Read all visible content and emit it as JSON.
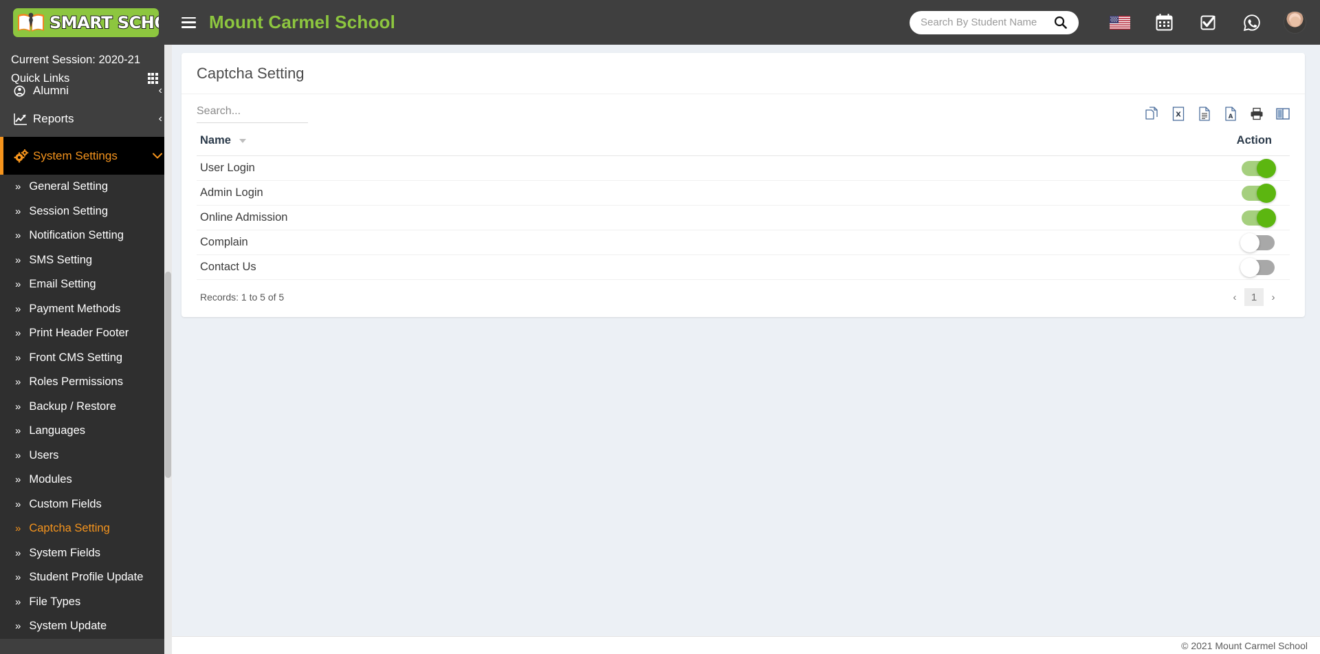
{
  "app": {
    "logo_text": "SMART SCHOOL",
    "brand_title": "Mount Carmel School"
  },
  "topbar": {
    "hamburger_icon": "hamburger-icon",
    "search": {
      "placeholder": "Search By Student Name",
      "value": "",
      "icon": "search-icon"
    },
    "icons": [
      {
        "name": "flag-usa-icon",
        "label": "Language"
      },
      {
        "name": "calendar-icon",
        "label": "Calendar"
      },
      {
        "name": "checkbox-task-icon",
        "label": "Tasks"
      },
      {
        "name": "whatsapp-icon",
        "label": "WhatsApp"
      }
    ],
    "avatar_name": "avatar"
  },
  "sidebar": {
    "session_label": "Current Session: 2020-21",
    "quick_links_label": "Quick Links",
    "quick_links_icon": "grid-icon",
    "top_items": [
      {
        "label": "Alumni",
        "icon": "alumni-icon",
        "caret": "‹",
        "state": "collapsed"
      },
      {
        "label": "Reports",
        "icon": "chart-line-icon",
        "caret": "‹",
        "state": "collapsed"
      },
      {
        "label": "System Settings",
        "icon": "gears-icon",
        "caret": "⌄",
        "state": "expanded"
      }
    ],
    "submenu": [
      {
        "label": "General Setting",
        "active": false
      },
      {
        "label": "Session Setting",
        "active": false
      },
      {
        "label": "Notification Setting",
        "active": false
      },
      {
        "label": "SMS Setting",
        "active": false
      },
      {
        "label": "Email Setting",
        "active": false
      },
      {
        "label": "Payment Methods",
        "active": false
      },
      {
        "label": "Print Header Footer",
        "active": false
      },
      {
        "label": "Front CMS Setting",
        "active": false
      },
      {
        "label": "Roles Permissions",
        "active": false
      },
      {
        "label": "Backup / Restore",
        "active": false
      },
      {
        "label": "Languages",
        "active": false
      },
      {
        "label": "Users",
        "active": false
      },
      {
        "label": "Modules",
        "active": false
      },
      {
        "label": "Custom Fields",
        "active": false
      },
      {
        "label": "Captcha Setting",
        "active": true
      },
      {
        "label": "System Fields",
        "active": false
      },
      {
        "label": "Student Profile Update",
        "active": false
      },
      {
        "label": "File Types",
        "active": false
      },
      {
        "label": "System Update",
        "active": false
      }
    ]
  },
  "page": {
    "title": "Captcha Setting"
  },
  "datatable": {
    "search_placeholder": "Search...",
    "search_value": "",
    "export_buttons": [
      {
        "name": "copy-icon",
        "label": "Copy"
      },
      {
        "name": "excel-icon",
        "label": "Excel"
      },
      {
        "name": "csv-icon",
        "label": "CSV"
      },
      {
        "name": "pdf-icon",
        "label": "PDF"
      },
      {
        "name": "print-icon",
        "label": "Print"
      },
      {
        "name": "column-visibility-icon",
        "label": "Column visibility"
      }
    ],
    "columns": [
      {
        "label": "Name",
        "sortable": true,
        "sort_state": "desc"
      },
      {
        "label": "Action",
        "sortable": false
      }
    ],
    "rows": [
      {
        "name": "User Login",
        "enabled": true
      },
      {
        "name": "Admin Login",
        "enabled": true
      },
      {
        "name": "Online Admission",
        "enabled": true
      },
      {
        "name": "Complain",
        "enabled": false
      },
      {
        "name": "Contact Us",
        "enabled": false
      }
    ],
    "info": "Records: 1 to 5 of 5",
    "pagination": {
      "prev": "‹",
      "pages": [
        "1"
      ],
      "current": "1",
      "next": "›"
    }
  },
  "footer": {
    "copyright": "© 2021 Mount Carmel School"
  },
  "colors": {
    "brand_green": "#8dc63f",
    "accent_orange": "#f5941d",
    "sidebar_bg": "#3f3f3f",
    "submenu_bg": "#2f2f2f",
    "toggle_on": "#5cb610",
    "toggle_off": "#a8a8a8",
    "content_bg": "#ecf0f5"
  }
}
